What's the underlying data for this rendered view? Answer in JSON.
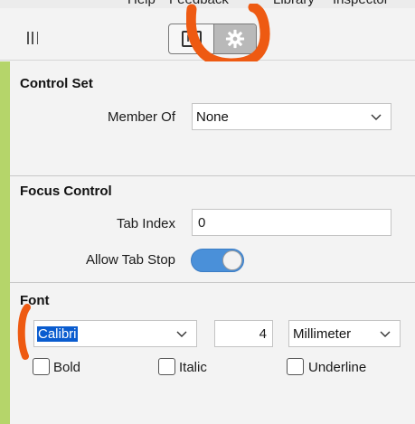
{
  "menu": {
    "items": [
      "Help",
      "Feedback",
      "Library",
      "Inspector"
    ]
  },
  "toolbar": {
    "tab_id_label": "ID",
    "tab_id_icon": "id-card-icon",
    "tab_settings_icon": "gear-icon",
    "grip_icon": "grip-lines-icon"
  },
  "control_set": {
    "title": "Control Set",
    "member_of_label": "Member Of",
    "member_of_value": "None"
  },
  "focus_control": {
    "title": "Focus Control",
    "tab_index_label": "Tab Index",
    "tab_index_value": "0",
    "allow_tab_stop_label": "Allow Tab Stop",
    "allow_tab_stop_on": true
  },
  "font": {
    "title": "Font",
    "name_value": "Calibri",
    "size_value": "4",
    "unit_value": "Millimeter",
    "bold_label": "Bold",
    "italic_label": "Italic",
    "underline_label": "Underline"
  },
  "colors": {
    "accent_green": "#b5d56a",
    "toggle_blue": "#4a90d9",
    "annotation_orange": "#ee5a12",
    "selection_blue": "#0a5ccf"
  }
}
